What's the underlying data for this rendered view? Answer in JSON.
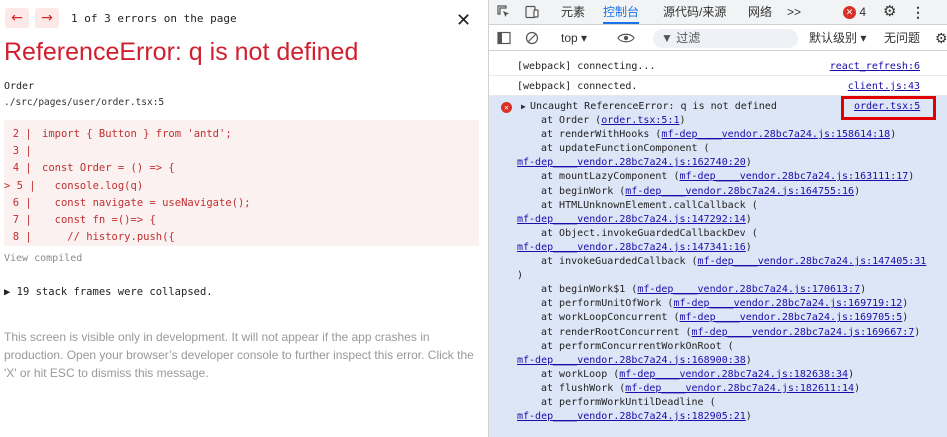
{
  "overlay": {
    "prev_arrow": "←",
    "next_arrow": "→",
    "error_count": "1 of 3 errors on the page",
    "close": "✕",
    "title": "ReferenceError: q is not defined",
    "file_heading": "Order",
    "file_path": "./src/pages/user/order.tsx:5",
    "code_lines": [
      {
        "no": "2",
        "marker": "",
        "text": "import { Button } from 'antd';"
      },
      {
        "no": "3",
        "marker": "",
        "text": ""
      },
      {
        "no": "4",
        "marker": "",
        "text": "const Order = () => {"
      },
      {
        "no": "5",
        "marker": ">",
        "text": "  console.log(q)"
      },
      {
        "no": "6",
        "marker": "",
        "text": "  const navigate = useNavigate();"
      },
      {
        "no": "7",
        "marker": "",
        "text": "  const fn =()=> {"
      },
      {
        "no": "8",
        "marker": "",
        "text": "    // history.push({"
      }
    ],
    "view_compiled": "View compiled",
    "collapsed_frames": "▶ 19 stack frames were collapsed.",
    "dev_note": "This screen is visible only in development. It will not appear if the app crashes in production. Open your browser’s developer console to further inspect this error.  Click the 'X' or hit ESC to dismiss this message."
  },
  "devtools": {
    "tabs": {
      "elements": "元素",
      "console": "控制台",
      "sources": "源代码/来源",
      "network": "网络",
      "more": ">>",
      "error_count": "4"
    },
    "toolbar": {
      "context": "top ▾",
      "filter": "过滤",
      "levels": "默认级别 ▾",
      "issues": "无问题"
    },
    "logs": [
      {
        "text": "[webpack] connecting...",
        "source": "react_refresh:6"
      },
      {
        "text": "[webpack] connected.",
        "source": "client.js:43"
      }
    ],
    "error": {
      "message": "Uncaught ReferenceError: q is not defined",
      "source": "order.tsx:5",
      "stack": [
        {
          "indent": true,
          "pre": "at Order (",
          "link": "order.tsx:5:1",
          "post": ")"
        },
        {
          "indent": true,
          "pre": "at renderWithHooks (",
          "link": "mf-dep____vendor.28bc7a24.js:158614:18",
          "post": ")"
        },
        {
          "indent": true,
          "pre": "at updateFunctionComponent (",
          "link": "",
          "post": ""
        },
        {
          "indent": false,
          "pre": "",
          "link": "mf-dep____vendor.28bc7a24.js:162740:20",
          "post": ")"
        },
        {
          "indent": true,
          "pre": "at mountLazyComponent (",
          "link": "mf-dep____vendor.28bc7a24.js:163111:17",
          "post": ")"
        },
        {
          "indent": true,
          "pre": "at beginWork (",
          "link": "mf-dep____vendor.28bc7a24.js:164755:16",
          "post": ")"
        },
        {
          "indent": true,
          "pre": "at HTMLUnknownElement.callCallback (",
          "link": "",
          "post": ""
        },
        {
          "indent": false,
          "pre": "",
          "link": "mf-dep____vendor.28bc7a24.js:147292:14",
          "post": ")"
        },
        {
          "indent": true,
          "pre": "at Object.invokeGuardedCallbackDev (",
          "link": "",
          "post": ""
        },
        {
          "indent": false,
          "pre": "",
          "link": "mf-dep____vendor.28bc7a24.js:147341:16",
          "post": ")"
        },
        {
          "indent": true,
          "pre": "at invokeGuardedCallback (",
          "link": "mf-dep____vendor.28bc7a24.js:147405:31",
          "post": ""
        },
        {
          "indent": false,
          "pre": ")",
          "link": "",
          "post": ""
        },
        {
          "indent": true,
          "pre": "at beginWork$1 (",
          "link": "mf-dep____vendor.28bc7a24.js:170613:7",
          "post": ")"
        },
        {
          "indent": true,
          "pre": "at performUnitOfWork (",
          "link": "mf-dep____vendor.28bc7a24.js:169719:12",
          "post": ")"
        },
        {
          "indent": true,
          "pre": "at workLoopConcurrent (",
          "link": "mf-dep____vendor.28bc7a24.js:169705:5",
          "post": ")"
        },
        {
          "indent": true,
          "pre": "at renderRootConcurrent (",
          "link": "mf-dep____vendor.28bc7a24.js:169667:7",
          "post": ")"
        },
        {
          "indent": true,
          "pre": "at performConcurrentWorkOnRoot (",
          "link": "",
          "post": ""
        },
        {
          "indent": false,
          "pre": "",
          "link": "mf-dep____vendor.28bc7a24.js:168900:38",
          "post": ")"
        },
        {
          "indent": true,
          "pre": "at workLoop (",
          "link": "mf-dep____vendor.28bc7a24.js:182638:34",
          "post": ")"
        },
        {
          "indent": true,
          "pre": "at flushWork (",
          "link": "mf-dep____vendor.28bc7a24.js:182611:14",
          "post": ")"
        },
        {
          "indent": true,
          "pre": "at performWorkUntilDeadline (",
          "link": "",
          "post": ""
        },
        {
          "indent": false,
          "pre": "",
          "link": "mf-dep____vendor.28bc7a24.js:182905:21",
          "post": ")"
        }
      ]
    }
  }
}
